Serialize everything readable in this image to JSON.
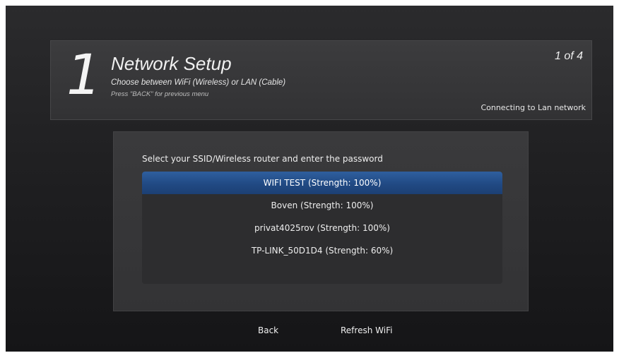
{
  "header": {
    "step_number": "1",
    "title": "Network Setup",
    "subtitle": "Choose between WiFi (Wireless) or LAN (Cable)",
    "hint": "Press \"BACK\" for previous menu",
    "step_indicator": "1 of 4",
    "status": "Connecting to Lan network"
  },
  "main": {
    "instruction": "Select your SSID/Wireless router and enter the password",
    "networks": [
      {
        "label": "WIFI TEST (Strength: 100%)",
        "selected": true
      },
      {
        "label": "Boven (Strength: 100%)",
        "selected": false
      },
      {
        "label": "privat4025rov (Strength: 100%)",
        "selected": false
      },
      {
        "label": "TP-LINK_50D1D4 (Strength: 60%)",
        "selected": false
      }
    ]
  },
  "footer": {
    "back_label": "Back",
    "refresh_label": "Refresh WiFi"
  },
  "colors": {
    "selection": "#214a84",
    "background": "#1c1c1e",
    "panel": "#363638"
  }
}
